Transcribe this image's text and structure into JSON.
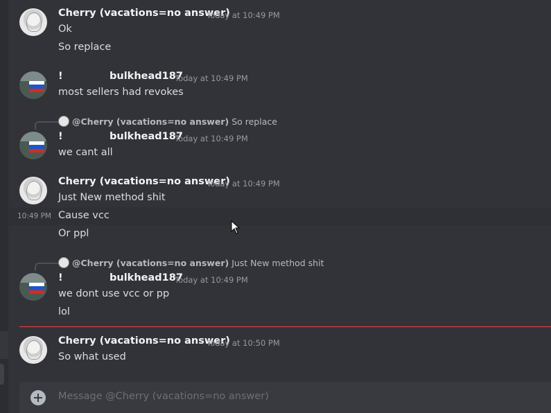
{
  "messages": [
    {
      "author": "Cherry (vacations=no answer)",
      "time": "Today at 10:49 PM",
      "lines": [
        "Ok",
        "So replace"
      ]
    },
    {
      "prefix": "!",
      "author": "bulkhead187",
      "time": "Today at 10:49 PM",
      "lines": [
        "most sellers had revokes"
      ]
    },
    {
      "reply": {
        "author": "@Cherry (vacations=no answer)",
        "text": "So replace"
      },
      "prefix": "!",
      "author": "bulkhead187",
      "time": "Today at 10:49 PM",
      "lines": [
        "we cant all"
      ]
    },
    {
      "author": "Cherry (vacations=no answer)",
      "time": "Today at 10:49 PM",
      "lines": [
        "Just New method shit",
        "Cause vcc",
        "Or ppl"
      ],
      "hover_time": "10:49 PM"
    },
    {
      "reply": {
        "author": "@Cherry (vacations=no answer)",
        "text": "Just New method shit"
      },
      "prefix": "!",
      "author": "bulkhead187",
      "time": "Today at 10:49 PM",
      "lines": [
        "we dont use vcc or pp",
        "lol"
      ]
    },
    {
      "author": "Cherry (vacations=no answer)",
      "time": "Today at 10:50 PM",
      "lines": [
        "So what used"
      ]
    }
  ],
  "composer": {
    "placeholder": "Message @Cherry (vacations=no answer)"
  },
  "colors": {
    "background": "#313338",
    "new_messages_divider": "#f23f43",
    "flag": [
      "#ffffff",
      "#1c57c9",
      "#d52b1e"
    ]
  },
  "icons": {
    "attach": "plus-circle-icon",
    "cursor": "mouse-pointer-icon"
  }
}
